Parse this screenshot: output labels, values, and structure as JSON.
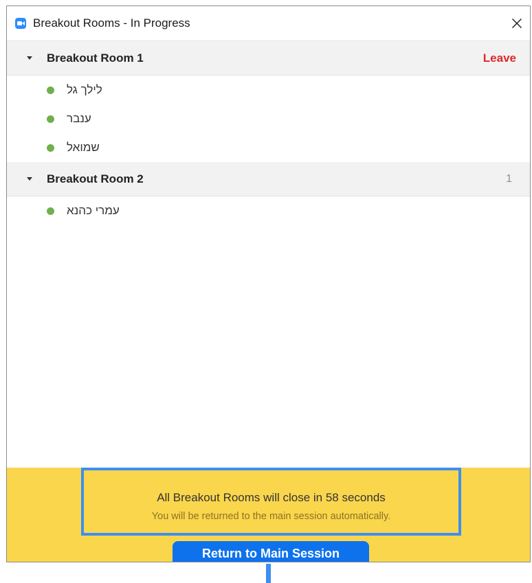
{
  "window": {
    "title": "Breakout Rooms - In Progress",
    "app_icon": "zoom-camera-icon",
    "close_icon": "close-icon"
  },
  "rooms": [
    {
      "name": "Breakout Room 1",
      "action_label": "Leave",
      "participants": [
        "לילך גל",
        "ענבר",
        "שמואל"
      ]
    },
    {
      "name": "Breakout Room 2",
      "count": "1",
      "participants": [
        "עמרי כהנא"
      ]
    }
  ],
  "footer": {
    "notice_main": "All Breakout Rooms will close in 58 seconds",
    "notice_sub": "You will be returned to the main session automatically.",
    "return_button": "Return to Main Session"
  },
  "colors": {
    "accent": "#0e72ed",
    "leave": "#e02828",
    "status_online": "#6fb04e",
    "banner": "#fad64d",
    "highlight": "#3d8ef0"
  }
}
